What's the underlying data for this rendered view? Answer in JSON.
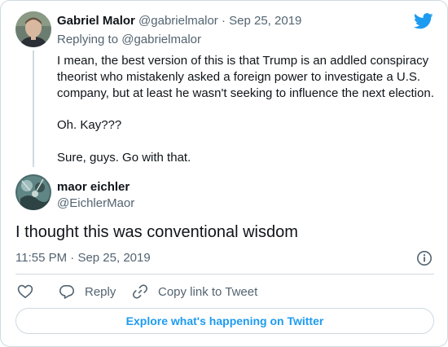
{
  "colors": {
    "accent": "#1d9bf0",
    "muted": "#536471",
    "text": "#0f1419",
    "border": "#cfd9de"
  },
  "parent_tweet": {
    "author_name": "Gabriel Malor",
    "handle": "@gabrielmalor",
    "separator": "·",
    "date": "Sep 25, 2019",
    "replying_prefix": "Replying to ",
    "replying_to": "@gabrielmalor",
    "paragraphs": [
      "I mean, the best version of this is that Trump is an addled conspiracy theorist who mistakenly asked a foreign power to investigate a U.S. company, but at least he wasn't seeking to influence the next election.",
      "Oh. Kay???",
      "Sure, guys. Go with that."
    ]
  },
  "main_tweet": {
    "author_name": "maor eichler",
    "handle": "@EichlerMaor",
    "text": "I thought this was conventional wisdom",
    "time": "11:55 PM",
    "separator": "·",
    "date": "Sep 25, 2019"
  },
  "actions": {
    "like_icon": "heart-icon",
    "reply_label": "Reply",
    "copy_label": "Copy link to Tweet"
  },
  "explore_label": "Explore what's happening on Twitter",
  "icons": {
    "logo": "twitter-bird-icon",
    "info": "info-icon"
  }
}
